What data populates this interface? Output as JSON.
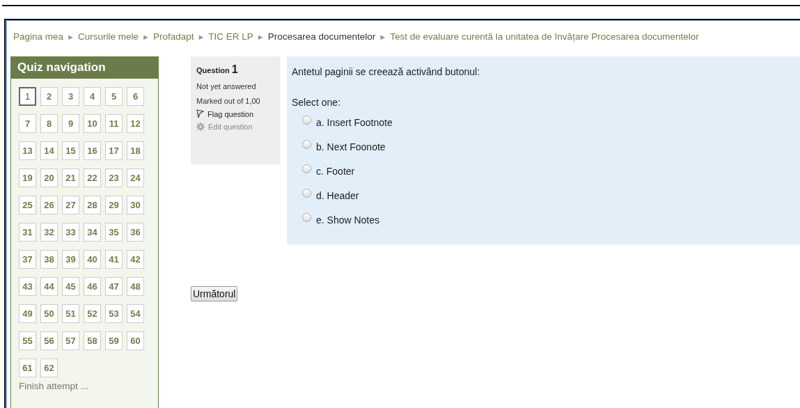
{
  "breadcrumb": [
    {
      "label": "Pagina mea",
      "link": true
    },
    {
      "label": "Cursurile mele",
      "link": true
    },
    {
      "label": "Profadapt",
      "link": true
    },
    {
      "label": "TIC ER LP",
      "link": true
    },
    {
      "label": "Procesarea documentelor",
      "link": false
    },
    {
      "label": "Test de evaluare curentă la unitatea de învățare Procesarea documentelor",
      "link": true
    }
  ],
  "separator": "►",
  "quiz_navigation": {
    "title": "Quiz navigation",
    "questions": [
      {
        "label": "1",
        "selected": true
      },
      {
        "label": "2",
        "selected": false
      },
      {
        "label": "3",
        "selected": false
      },
      {
        "label": "4",
        "selected": false
      },
      {
        "label": "5",
        "selected": false
      },
      {
        "label": "6",
        "selected": false
      },
      {
        "label": "7",
        "selected": false
      },
      {
        "label": "8",
        "selected": false
      },
      {
        "label": "9",
        "selected": false
      },
      {
        "label": "10",
        "selected": false
      },
      {
        "label": "11",
        "selected": false
      },
      {
        "label": "12",
        "selected": false
      },
      {
        "label": "13",
        "selected": false
      },
      {
        "label": "14",
        "selected": false
      },
      {
        "label": "15",
        "selected": false
      },
      {
        "label": "16",
        "selected": false
      },
      {
        "label": "17",
        "selected": false
      },
      {
        "label": "18",
        "selected": false
      },
      {
        "label": "19",
        "selected": false
      },
      {
        "label": "20",
        "selected": false
      },
      {
        "label": "21",
        "selected": false
      },
      {
        "label": "22",
        "selected": false
      },
      {
        "label": "23",
        "selected": false
      },
      {
        "label": "24",
        "selected": false
      },
      {
        "label": "25",
        "selected": false
      },
      {
        "label": "26",
        "selected": false
      },
      {
        "label": "27",
        "selected": false
      },
      {
        "label": "28",
        "selected": false
      },
      {
        "label": "29",
        "selected": false
      },
      {
        "label": "30",
        "selected": false
      },
      {
        "label": "31",
        "selected": false
      },
      {
        "label": "32",
        "selected": false
      },
      {
        "label": "33",
        "selected": false
      },
      {
        "label": "34",
        "selected": false
      },
      {
        "label": "35",
        "selected": false
      },
      {
        "label": "36",
        "selected": false
      },
      {
        "label": "37",
        "selected": false
      },
      {
        "label": "38",
        "selected": false
      },
      {
        "label": "39",
        "selected": false
      },
      {
        "label": "40",
        "selected": false
      },
      {
        "label": "41",
        "selected": false
      },
      {
        "label": "42",
        "selected": false
      },
      {
        "label": "43",
        "selected": false
      },
      {
        "label": "44",
        "selected": false
      },
      {
        "label": "45",
        "selected": false
      },
      {
        "label": "46",
        "selected": false
      },
      {
        "label": "47",
        "selected": false
      },
      {
        "label": "48",
        "selected": false
      },
      {
        "label": "49",
        "selected": false
      },
      {
        "label": "50",
        "selected": false
      },
      {
        "label": "51",
        "selected": false
      },
      {
        "label": "52",
        "selected": false
      },
      {
        "label": "53",
        "selected": false
      },
      {
        "label": "54",
        "selected": false
      },
      {
        "label": "55",
        "selected": false
      },
      {
        "label": "56",
        "selected": false
      },
      {
        "label": "57",
        "selected": false
      },
      {
        "label": "58",
        "selected": false
      },
      {
        "label": "59",
        "selected": false
      },
      {
        "label": "60",
        "selected": false
      },
      {
        "label": "61",
        "selected": false
      },
      {
        "label": "62",
        "selected": false
      }
    ],
    "finish_link": "Finish attempt ..."
  },
  "question_info": {
    "label": "Question",
    "number": "1",
    "state": "Not yet answered",
    "marks": "Marked out of 1,00",
    "flag": "Flag question",
    "edit": "Edit question"
  },
  "question": {
    "text": "Antetul paginii se creează activând butonul:",
    "prompt": "Select one:",
    "options": [
      {
        "label": "a. Insert Footnote",
        "selected": false
      },
      {
        "label": "b. Next Foonote",
        "selected": false
      },
      {
        "label": "c. Footer",
        "selected": false
      },
      {
        "label": "d. Header",
        "selected": false
      },
      {
        "label": "e. Show Notes",
        "selected": false
      }
    ]
  },
  "next_button": "Următorul"
}
